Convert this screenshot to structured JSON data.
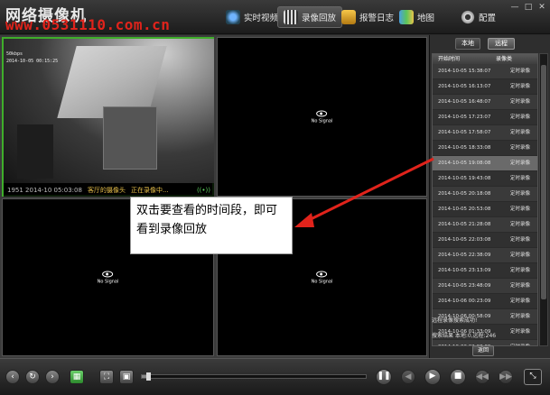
{
  "app": {
    "title": "网络摄像机",
    "watermark": "www.0531110.com.cn"
  },
  "nav": [
    {
      "label": "实时视频",
      "icon": "camera-icon"
    },
    {
      "label": "录像回放",
      "icon": "film-icon"
    },
    {
      "label": "报警日志",
      "icon": "alarm-log-icon"
    },
    {
      "label": "地图",
      "icon": "map-icon"
    },
    {
      "label": "配置",
      "icon": "gear-icon"
    }
  ],
  "video": {
    "no_signal": "No Signal",
    "cam1_status": "1951 2014-10 05:03:08",
    "cam1_label": "客厅的摄像头",
    "cam1_state": "正在录像中...",
    "feed_overlay_1": "50kbps",
    "feed_overlay_2": "2014-10-05 00:15:25"
  },
  "annotation": {
    "text": "双击要查看的时间段，即可看到录像回放"
  },
  "panel": {
    "tab_local": "本地",
    "tab_remote": "远程",
    "col_start": "开始时间",
    "col_type": "录像类",
    "records": [
      {
        "time": "2014-10-05 15:38:07",
        "type": "定时录像"
      },
      {
        "time": "2014-10-05 16:13:07",
        "type": "定时录像"
      },
      {
        "time": "2014-10-05 16:48:07",
        "type": "定时录像"
      },
      {
        "time": "2014-10-05 17:23:07",
        "type": "定时录像"
      },
      {
        "time": "2014-10-05 17:58:07",
        "type": "定时录像"
      },
      {
        "time": "2014-10-05 18:33:08",
        "type": "定时录像"
      },
      {
        "time": "2014-10-05 19:08:08",
        "type": "定时录像"
      },
      {
        "time": "2014-10-05 19:43:08",
        "type": "定时录像"
      },
      {
        "time": "2014-10-05 20:18:08",
        "type": "定时录像"
      },
      {
        "time": "2014-10-05 20:53:08",
        "type": "定时录像"
      },
      {
        "time": "2014-10-05 21:28:08",
        "type": "定时录像"
      },
      {
        "time": "2014-10-05 22:03:08",
        "type": "定时录像"
      },
      {
        "time": "2014-10-05 22:38:09",
        "type": "定时录像"
      },
      {
        "time": "2014-10-05 23:13:09",
        "type": "定时录像"
      },
      {
        "time": "2014-10-05 23:48:09",
        "type": "定时录像"
      },
      {
        "time": "2014-10-06 00:23:09",
        "type": "定时录像"
      },
      {
        "time": "2014-10-06 00:58:09",
        "type": "定时录像"
      },
      {
        "time": "2014-10-06 01:33:09",
        "type": "定时录像"
      },
      {
        "time": "2014-10-06 02:08:09",
        "type": "定时录像"
      }
    ],
    "search_message": "远程录像搜索成功!",
    "search_result": "搜索结果 本地:0,远程:246",
    "back_label": "返回"
  },
  "playback": {
    "progress": 0.02
  },
  "colors": {
    "accent_red": "#e0231b",
    "selected_border": "#3fae2a"
  }
}
